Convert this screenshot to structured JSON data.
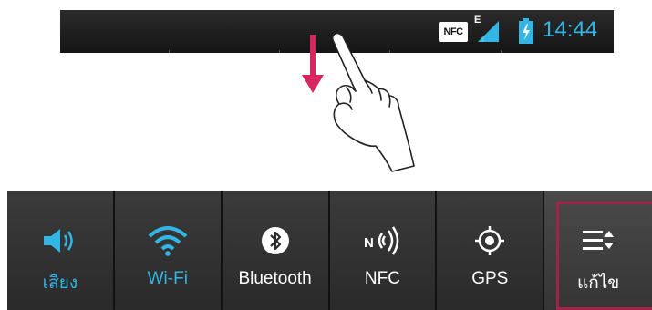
{
  "status_bar": {
    "nfc_badge": "NFC",
    "network_type": "E",
    "time": "14:44"
  },
  "quick_settings": {
    "tiles": [
      {
        "label": "เสียง",
        "icon": "volume-icon",
        "active": true
      },
      {
        "label": "Wi-Fi",
        "icon": "wifi-icon",
        "active": true
      },
      {
        "label": "Bluetooth",
        "icon": "bluetooth-icon",
        "active": false
      },
      {
        "label": "NFC",
        "icon": "nfc-icon",
        "active": false
      },
      {
        "label": "GPS",
        "icon": "gps-icon",
        "active": false
      },
      {
        "label": "แก้ไข",
        "icon": "edit-list-icon",
        "active": false
      }
    ]
  },
  "colors": {
    "accent": "#33b5e5",
    "highlight_frame": "#a0244a",
    "arrow": "#d8265e"
  }
}
